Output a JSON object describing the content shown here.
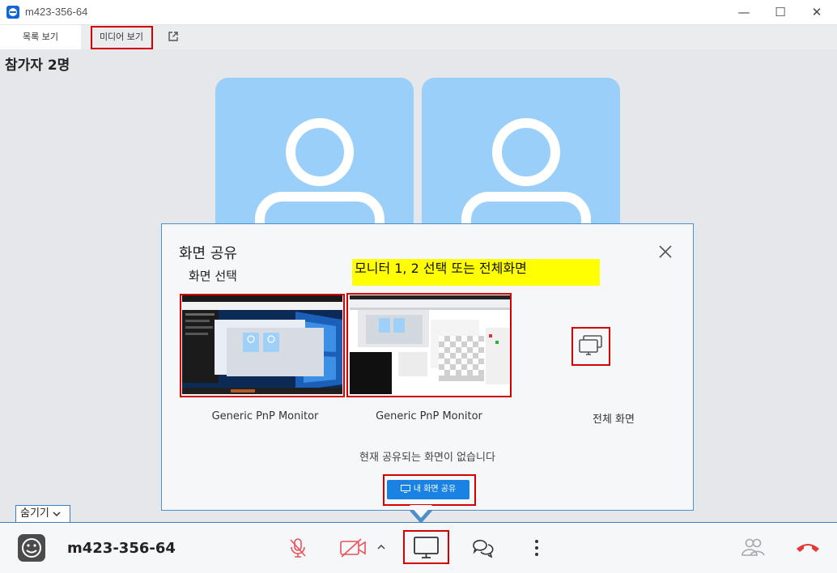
{
  "window": {
    "title": "m423-356-64",
    "minimize": "—",
    "maximize": "☐",
    "close": "✕"
  },
  "tabs": [
    {
      "label": "목록 보기"
    },
    {
      "label": "미디어 보기"
    }
  ],
  "participants": {
    "count_label": "참가자 2명"
  },
  "dialog": {
    "title": "화면 공유",
    "subtitle": "화면 선택",
    "annotation": "모니터 1, 2 선택 또는 전체화면",
    "monitors": [
      {
        "label": "Generic PnP Monitor"
      },
      {
        "label": "Generic PnP Monitor"
      }
    ],
    "full_screen_label": "전체 화면",
    "status": "현재 공유되는 화면이 없습니다",
    "share_button": "내 화면 공유"
  },
  "toolbar": {
    "hide_label": "숨기기",
    "meeting_id": "m423-356-64"
  },
  "colors": {
    "accent": "#1a82e2",
    "avatar_bg": "#99cff9",
    "mute_red": "#e8525a",
    "hangup_red": "#e53935",
    "annotation_red": "#d40000",
    "note_yellow": "#ffff00"
  }
}
